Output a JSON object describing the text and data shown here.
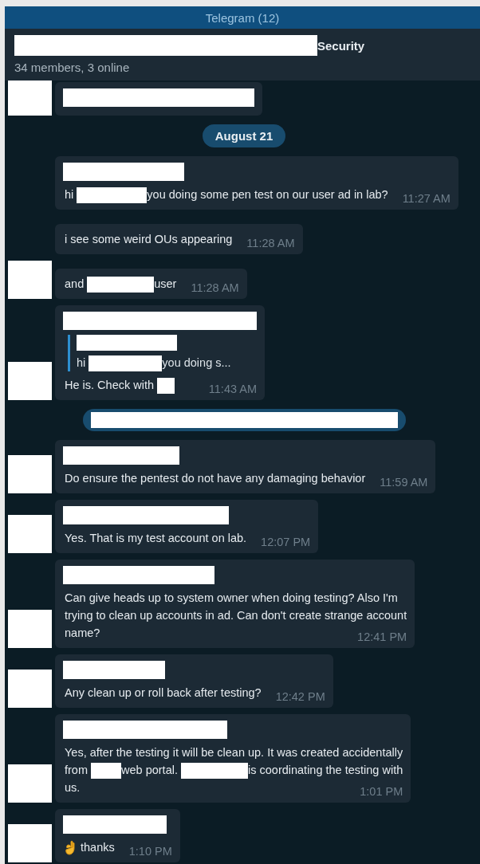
{
  "window": {
    "title": "Telegram (12)"
  },
  "chat": {
    "title_parts": [
      {
        "kind": "redacted"
      },
      {
        "kind": "text",
        "text": "Security"
      }
    ],
    "subtitle": "34 members, 3 online"
  },
  "items": [
    {
      "kind": "message",
      "avatar": true,
      "sender": {
        "kind": "redacted"
      }
    },
    {
      "kind": "date",
      "text": "August 21"
    },
    {
      "kind": "message",
      "avatar": false,
      "sender": {
        "kind": "redacted"
      },
      "lines": [
        {
          "parts": [
            {
              "kind": "text",
              "text": "hi "
            },
            {
              "kind": "redacted"
            },
            {
              "kind": "text",
              "text": "you doing some pen test on our user ad in lab?"
            }
          ]
        }
      ],
      "time": "11:27 AM"
    },
    {
      "kind": "message",
      "avatar": false,
      "lines": [
        {
          "parts": [
            {
              "kind": "text",
              "text": "i see some weird OUs appearing"
            }
          ]
        }
      ],
      "time": "11:28 AM"
    },
    {
      "kind": "message",
      "avatar": true,
      "lines": [
        {
          "parts": [
            {
              "kind": "text",
              "text": "and "
            },
            {
              "kind": "redacted"
            },
            {
              "kind": "text",
              "text": "user"
            }
          ]
        }
      ],
      "time": "11:28 AM"
    },
    {
      "kind": "message",
      "avatar": true,
      "sender": {
        "kind": "redacted"
      },
      "quote": {
        "sender": {
          "kind": "redacted"
        },
        "lines": [
          {
            "parts": [
              {
                "kind": "text",
                "text": "hi "
              },
              {
                "kind": "redacted"
              },
              {
                "kind": "text",
                "text": "you doing s..."
              }
            ]
          }
        ]
      },
      "lines": [
        {
          "parts": [
            {
              "kind": "text",
              "text": "He is. Check with "
            },
            {
              "kind": "redacted"
            }
          ]
        }
      ],
      "time": "11:43 AM"
    },
    {
      "kind": "service",
      "content": {
        "kind": "redacted"
      }
    },
    {
      "kind": "message",
      "avatar": true,
      "sender": {
        "kind": "redacted"
      },
      "lines": [
        {
          "parts": [
            {
              "kind": "text",
              "text": "Do ensure the pentest do not have any damaging behavior"
            }
          ]
        }
      ],
      "time": "11:59 AM"
    },
    {
      "kind": "message",
      "avatar": true,
      "sender": {
        "kind": "redacted"
      },
      "lines": [
        {
          "parts": [
            {
              "kind": "text",
              "text": "Yes. That is my test account on lab."
            }
          ]
        }
      ],
      "time": "12:07 PM"
    },
    {
      "kind": "message",
      "avatar": true,
      "sender": {
        "kind": "redacted"
      },
      "lines": [
        {
          "parts": [
            {
              "kind": "text",
              "text": "Can give heads up to system owner when doing testing? Also I'm"
            }
          ]
        },
        {
          "parts": [
            {
              "kind": "text",
              "text": "trying to clean up accounts in ad. Can don't create strange account"
            }
          ]
        },
        {
          "parts": [
            {
              "kind": "text",
              "text": "name?"
            }
          ]
        }
      ],
      "time": "12:41 PM"
    },
    {
      "kind": "message",
      "avatar": true,
      "sender": {
        "kind": "redacted"
      },
      "lines": [
        {
          "parts": [
            {
              "kind": "text",
              "text": "Any clean up or roll back after testing?"
            }
          ]
        }
      ],
      "time": "12:42 PM"
    },
    {
      "kind": "message",
      "avatar": true,
      "sender": {
        "kind": "redacted"
      },
      "lines": [
        {
          "parts": [
            {
              "kind": "text",
              "text": "Yes, after the testing it will be clean up. It was created accidentally"
            }
          ]
        },
        {
          "parts": [
            {
              "kind": "text",
              "text": "from "
            },
            {
              "kind": "redacted"
            },
            {
              "kind": "text",
              "text": "web portal. "
            },
            {
              "kind": "redacted"
            },
            {
              "kind": "text",
              "text": "is coordinating the testing with"
            }
          ]
        },
        {
          "parts": [
            {
              "kind": "text",
              "text": "us."
            }
          ]
        }
      ],
      "time": "1:01 PM"
    },
    {
      "kind": "message",
      "avatar": true,
      "sender": {
        "kind": "redacted"
      },
      "lines": [
        {
          "parts": [
            {
              "kind": "ok_hand"
            },
            {
              "kind": "text",
              "text": " thanks"
            }
          ]
        }
      ],
      "time": "1:10 PM"
    }
  ]
}
